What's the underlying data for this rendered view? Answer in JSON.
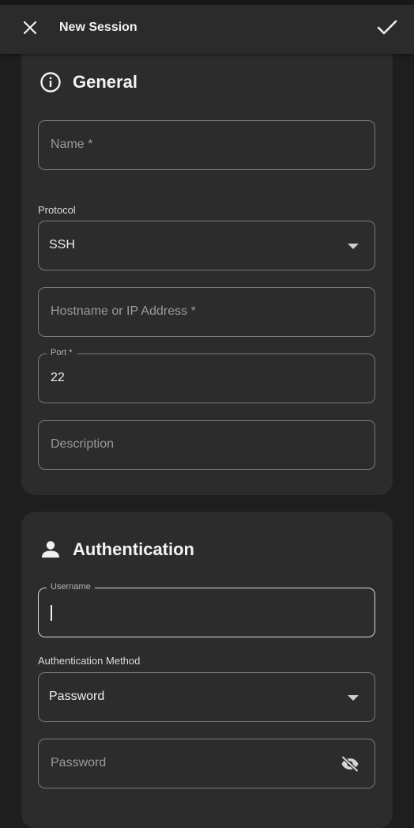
{
  "appbar": {
    "title": "New Session",
    "close_icon": "close-icon",
    "confirm_icon": "check-icon"
  },
  "general": {
    "title": "General",
    "icon": "info-icon",
    "name": {
      "placeholder": "Name *",
      "value": ""
    },
    "protocol": {
      "label": "Protocol",
      "value": "SSH"
    },
    "hostname": {
      "placeholder": "Hostname or IP Address *",
      "value": ""
    },
    "port": {
      "label": "Port *",
      "value": "22"
    },
    "description": {
      "placeholder": "Description",
      "value": ""
    }
  },
  "authentication": {
    "title": "Authentication",
    "icon": "person-icon",
    "username": {
      "label": "Username",
      "value": ""
    },
    "method": {
      "label": "Authentication Method",
      "value": "Password"
    },
    "password": {
      "placeholder": "Password",
      "value": "",
      "visibility_icon": "eye-off-icon"
    }
  },
  "colors": {
    "background": "#1e1e1e",
    "card": "#2c2c2c",
    "appbar": "#2b2b2b",
    "outline": "#7a7a7a",
    "text": "#e8e8e8"
  }
}
